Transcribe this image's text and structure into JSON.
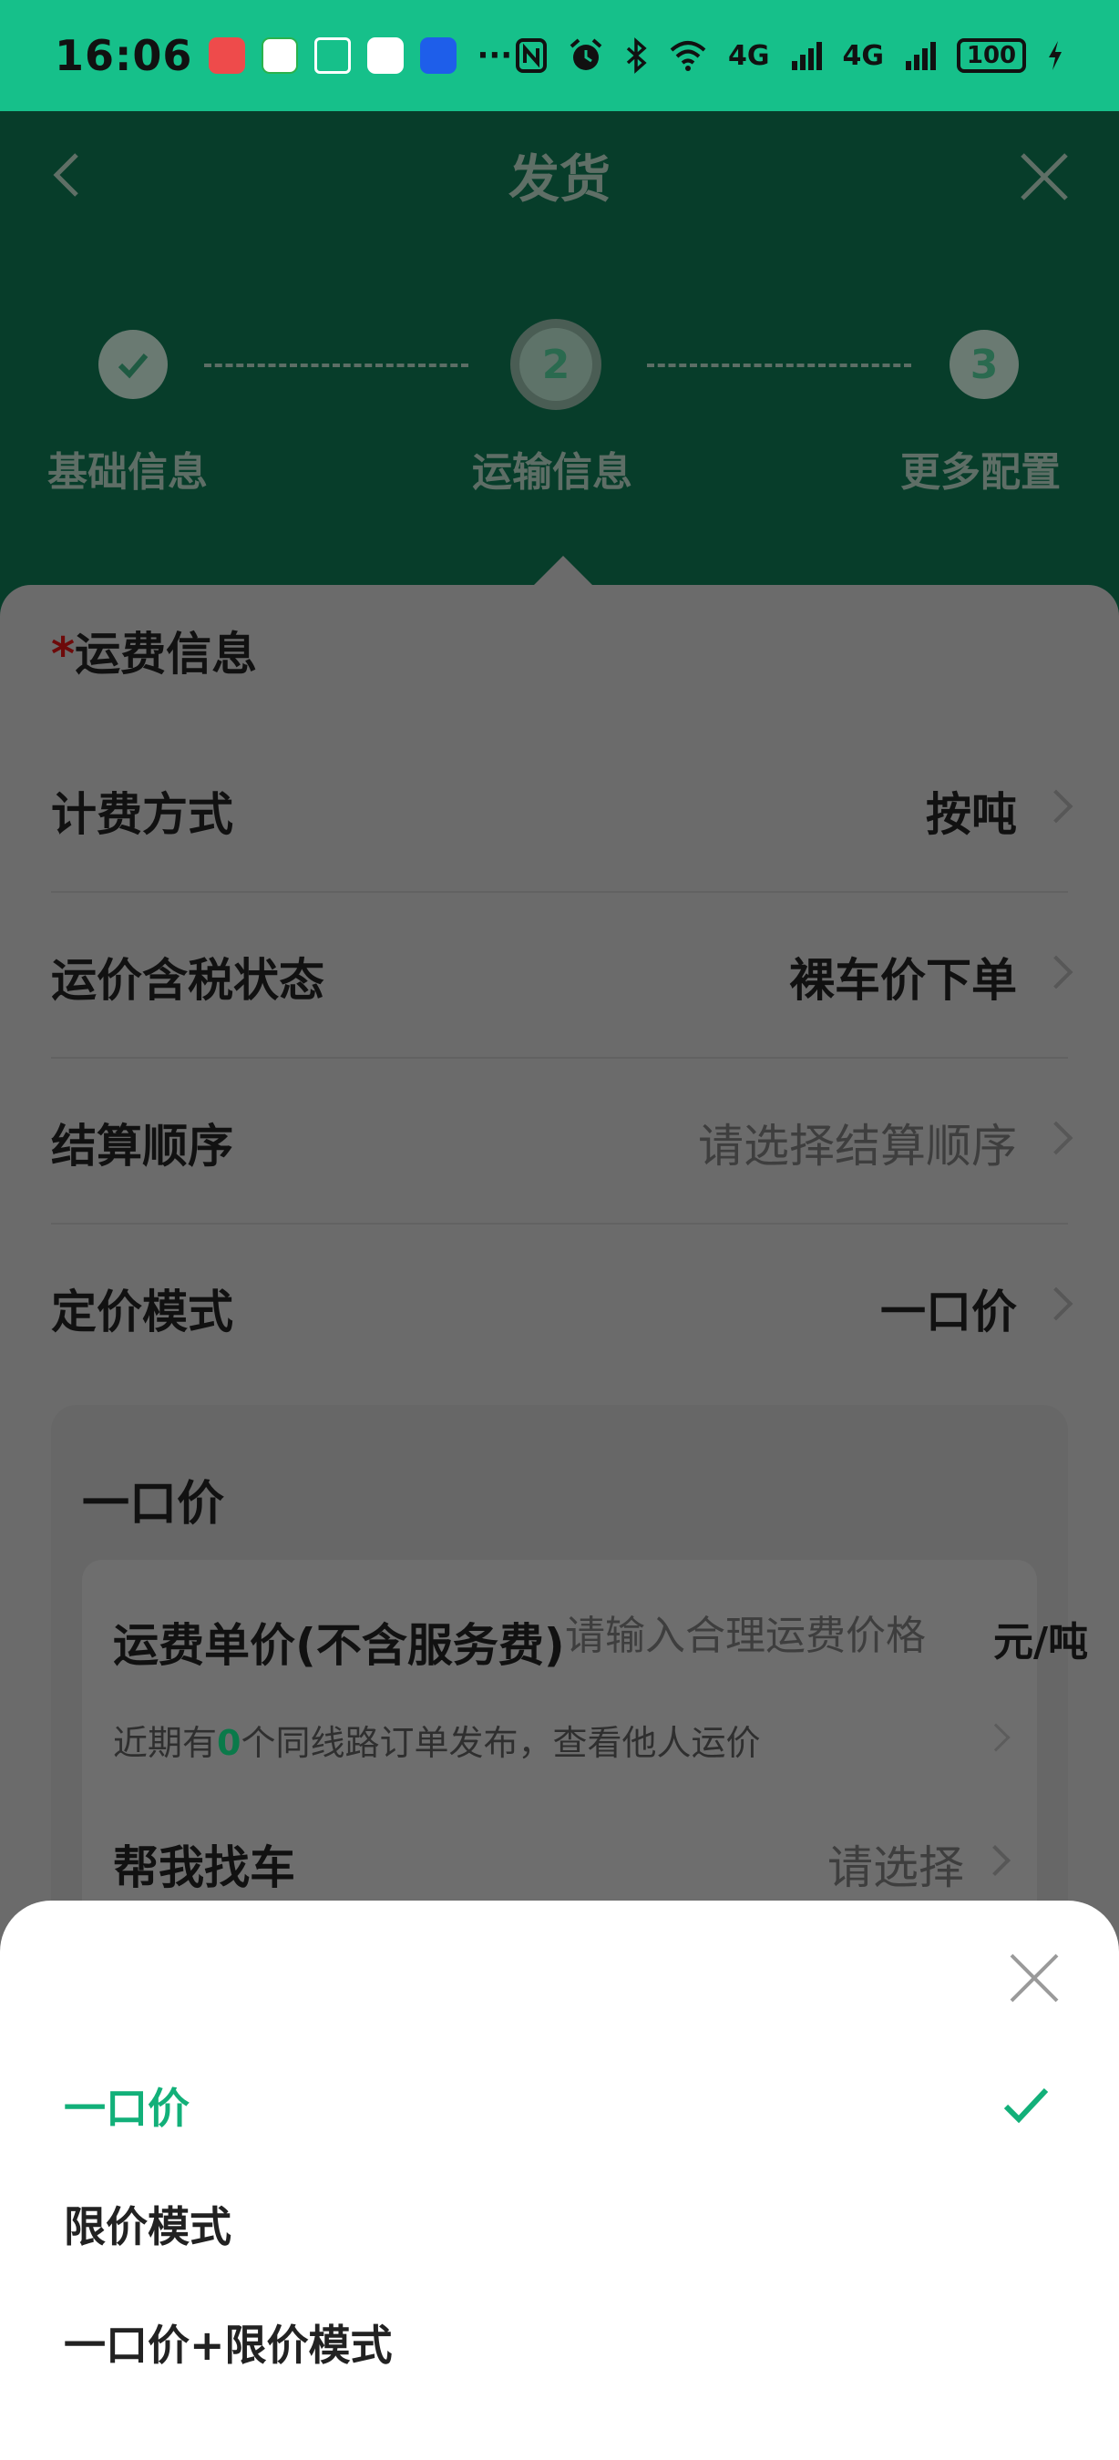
{
  "status_bar": {
    "time": "16:06",
    "more_dots": "···",
    "network_1": "4G",
    "network_2": "4G",
    "battery": "100",
    "icons": [
      "nfc-icon",
      "alarm-icon",
      "bluetooth-icon",
      "wifi-icon",
      "signal-icon",
      "charging-icon"
    ]
  },
  "header": {
    "title": "发货",
    "back_icon": "chevron-left-icon",
    "close_icon": "close-icon"
  },
  "stepper": {
    "steps": [
      {
        "label": "基础信息",
        "number": "",
        "state": "done"
      },
      {
        "label": "运输信息",
        "number": "2",
        "state": "active"
      },
      {
        "label": "更多配置",
        "number": "3",
        "state": "todo"
      }
    ]
  },
  "form": {
    "required_mark": "*",
    "section_title": "运费信息",
    "rows": [
      {
        "label": "计费方式",
        "value": "按吨",
        "is_placeholder": false
      },
      {
        "label": "运价含税状态",
        "value": "裸车价下单",
        "is_placeholder": false
      },
      {
        "label": "结算顺序",
        "value": "请选择结算顺序",
        "is_placeholder": true
      },
      {
        "label": "定价模式",
        "value": "一口价",
        "is_placeholder": false
      }
    ],
    "pricing_card": {
      "title": "一口价",
      "price_label": "运费单价(不含服务费)",
      "price_placeholder": "请输入合理运费价格",
      "unit": "元/吨",
      "hint_prefix": "近期有",
      "hint_count": "0",
      "hint_suffix": "个同线路订单发布，查看他人运价",
      "find_car_label": "帮我找车",
      "find_car_value": "请选择"
    }
  },
  "sheet": {
    "options": [
      {
        "label": "一口价",
        "selected": true
      },
      {
        "label": "限价模式",
        "selected": false
      },
      {
        "label": "一口价+限价模式",
        "selected": false
      }
    ],
    "accent_color": "#12b079"
  },
  "colors": {
    "status_bar_bg": "#16c08a",
    "header_bg": "#073d2a",
    "dim_overlay_card": "#6b6b6b"
  }
}
